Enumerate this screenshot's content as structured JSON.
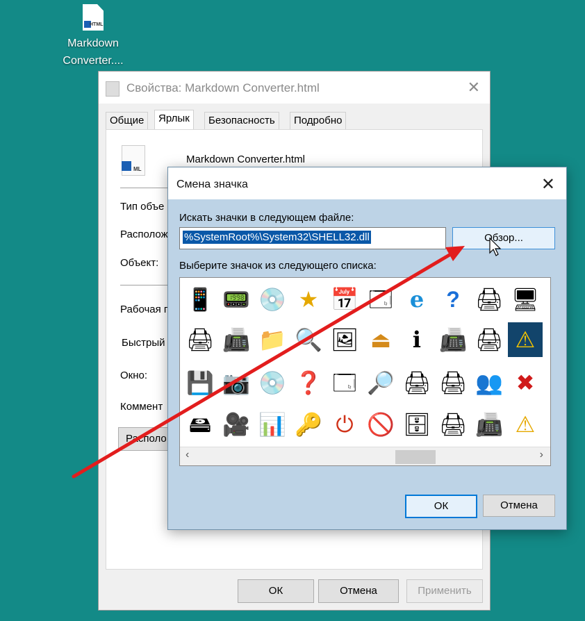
{
  "desktop": {
    "icon_name": "file-html-icon",
    "label": "Markdown Converter...."
  },
  "properties": {
    "title": "Свойства: Markdown Converter.html",
    "tabs": [
      "Общие",
      "Ярлык",
      "Безопасность",
      "Подробно"
    ],
    "active_tab": "Ярлык",
    "file_name": "Markdown Converter.html",
    "labels": [
      "Тип объе",
      "Располож",
      "Объект:",
      "Рабочая п",
      "Быстрый",
      "Окно:",
      "Коммент"
    ],
    "truncated_button": "Располо",
    "buttons": {
      "ok": "ОК",
      "cancel": "Отмена",
      "apply": "Применить"
    }
  },
  "dialog": {
    "title": "Смена значка",
    "search_label": "Искать значки в следующем файле:",
    "path_value": "%SystemRoot%\\System32\\SHELL32.dll",
    "browse": "Обзор...",
    "list_label": "Выберите значок из следующего списка:",
    "ok": "ОК",
    "cancel": "Отмена",
    "icons": [
      [
        "phone-icon",
        "pda-icon",
        "dvd-rw-icon",
        "star-icon",
        "folder-calendar-icon",
        "window-pen-icon",
        "internet-explorer-icon",
        "help-document-icon",
        "network-printer-icon",
        "computer-monitor-icon"
      ],
      [
        "printer-globe-icon",
        "scanner-icon",
        "folder-icon",
        "search-icon",
        "image-file-icon",
        "eject-icon",
        "info-icon",
        "fax-icon",
        "network-printer-icon",
        "warning-icon"
      ],
      [
        "disk-drive-icon",
        "camera-icon",
        "cd-icon",
        "help-circle-icon",
        "window-icon",
        "folder-search-icon",
        "printer-check-icon",
        "printer-search-icon",
        "printer-users-icon",
        "file-delete-icon"
      ],
      [
        "drive-icon",
        "camcorder-icon",
        "control-panel-icon",
        "key-icon",
        "power-icon",
        "no-entry-icon",
        "server-check-icon",
        "printer-note-icon",
        "fax-machine-icon",
        "warning-icon"
      ]
    ],
    "selected_icon": "warning-icon"
  },
  "colors": {
    "desktop": "#138a87",
    "dialog_bg": "#bdd3e6",
    "selection": "#0a58a8",
    "arrow": "#e21d1d"
  }
}
